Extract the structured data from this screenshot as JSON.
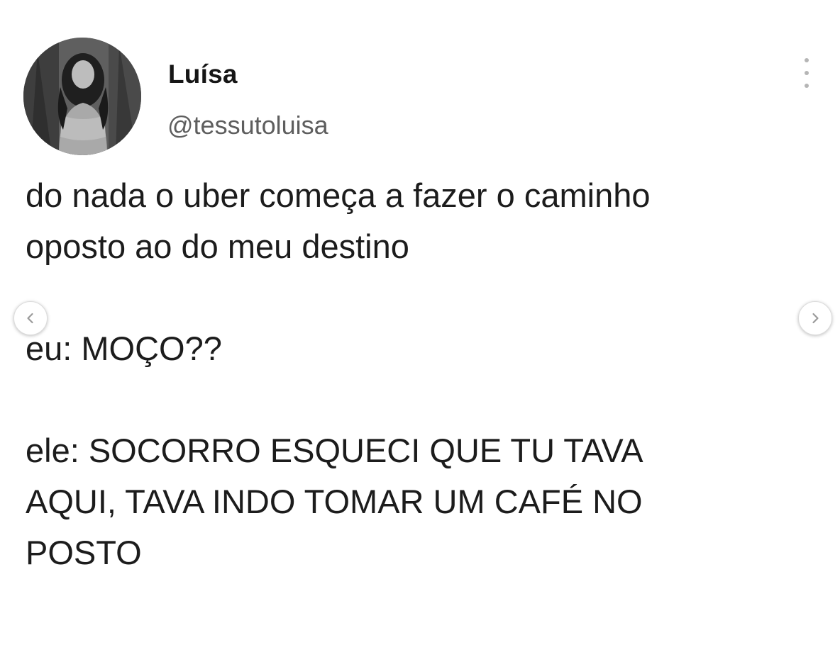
{
  "tweet": {
    "author": {
      "display_name": "Luísa",
      "handle": "@tessutoluisa"
    },
    "body": {
      "line1": "do nada o uber começa a fazer o caminho",
      "line2": "oposto ao do meu destino",
      "line3": "eu: MOÇO??",
      "line4": "ele: SOCORRO ESQUECI QUE TU TAVA",
      "line5": "AQUI, TAVA INDO TOMAR UM CAFÉ NO",
      "line6": "POSTO"
    }
  },
  "icons": {
    "more": "more-vertical-icon",
    "prev": "chevron-left-icon",
    "next": "chevron-right-icon"
  },
  "colors": {
    "background": "#ffffff",
    "text": "#1c1c1c",
    "handle": "#5e5e5e",
    "more_dots": "#b5b5b5"
  }
}
